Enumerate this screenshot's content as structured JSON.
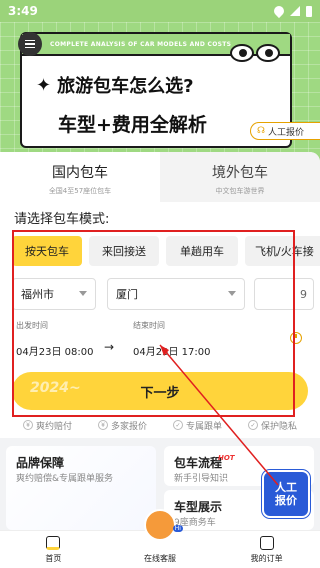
{
  "status": {
    "time": "3:49"
  },
  "banner": {
    "head_text": "COMPLETE ANALYSIS OF CAR MODELS AND COSTS",
    "line1": "旅游包车怎么选?",
    "line2": "车型+费用全解析",
    "quote_badge": "人工报价"
  },
  "tabs": [
    {
      "title": "国内包车",
      "sub": "全国4至57座位包车"
    },
    {
      "title": "境外包车",
      "sub": "中文包车游世界"
    }
  ],
  "form": {
    "title": "请选择包车模式:",
    "modes": [
      "按天包车",
      "来回接送",
      "单趟用车",
      "飞机/火车接"
    ],
    "from_city": "福州市",
    "to_city": "厦门",
    "passengers": "9",
    "depart_label": "出发时间",
    "depart_value": "04月23日 08:00",
    "end_label": "结束时间",
    "end_value": "04月23日 17:00",
    "next_button": "下一步",
    "next_watermark": "2024~"
  },
  "features": [
    {
      "icon": "¥",
      "label": "爽约赔付"
    },
    {
      "icon": "¥",
      "label": "多家报价"
    },
    {
      "icon": "✓",
      "label": "专属跟单"
    },
    {
      "icon": "✓",
      "label": "保护隐私"
    }
  ],
  "cards": {
    "brand": {
      "title": "品牌保障",
      "sub": "爽约赔偿&专属跟单服务"
    },
    "process": {
      "title": "包车流程",
      "hot": "HOT",
      "sub": "新手引导知识"
    },
    "models": {
      "title": "车型展示",
      "sub": "9座商务车"
    }
  },
  "float_quote": "人工\n报价",
  "nav": [
    {
      "label": "首页"
    },
    {
      "label": "在线客服"
    },
    {
      "label": "我的订单"
    }
  ],
  "mascot": {
    "badge": "Hi"
  }
}
